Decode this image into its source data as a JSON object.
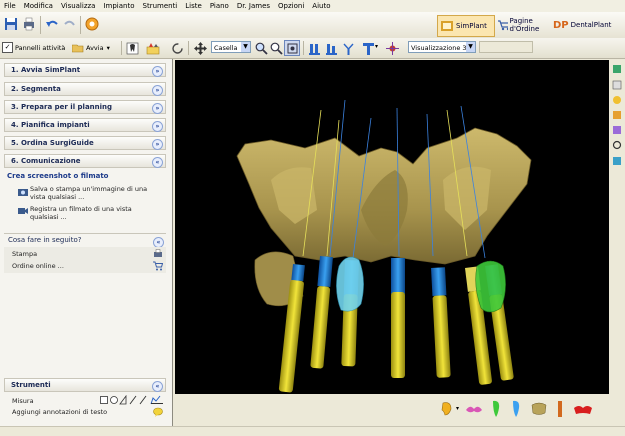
{
  "menu": [
    "File",
    "Modifica",
    "Visualizza",
    "Impianto",
    "Strumenti",
    "Liste",
    "Piano",
    "Dr. James",
    "Opzioni",
    "Aiuto"
  ],
  "mode_tabs": [
    {
      "label": "SimPlant",
      "icon": "simplant-icon",
      "active": true
    },
    {
      "label": "Pagine d'Ordine",
      "icon": "cart-icon",
      "active": false
    },
    {
      "label": "DentalPlant",
      "icon": "dp-logo-icon",
      "active": false
    }
  ],
  "toolbar2": {
    "panel_label": "Pannelli attività",
    "start_label": "Avvia",
    "selection_dropdown": "Casella",
    "view_dropdown": "Visualizzazione 3D"
  },
  "steps": [
    {
      "label": "1. Avvia SimPlant"
    },
    {
      "label": "2. Segmenta"
    },
    {
      "label": "3. Prepara per il planning"
    },
    {
      "label": "4. Pianifica impianti"
    },
    {
      "label": "5. Ordina SurgiGuide"
    },
    {
      "label": "6. Comunicazione"
    }
  ],
  "communication": {
    "title": "Crea screenshot o filmato",
    "actions": [
      {
        "label": "Salva o stampa un'immagine di una vista qualsiasi ..."
      },
      {
        "label": "Registra un filmato di una vista qualsiasi ..."
      }
    ]
  },
  "next": {
    "title": "Cosa fare in seguito?",
    "items": [
      {
        "label": "Stampa"
      },
      {
        "label": "Ordine online ..."
      }
    ]
  },
  "tools": {
    "title": "Strumenti",
    "measure_label": "Misura",
    "annotation_label": "Aggiungi annotazioni di testo"
  },
  "colors": {
    "bone": "#b7a35c",
    "implant_yellow": "#e8d92a",
    "implant_blue": "#1f7fd8",
    "nerve_cyan": "#6fd9f0",
    "tooth_green": "#3fc23f"
  }
}
